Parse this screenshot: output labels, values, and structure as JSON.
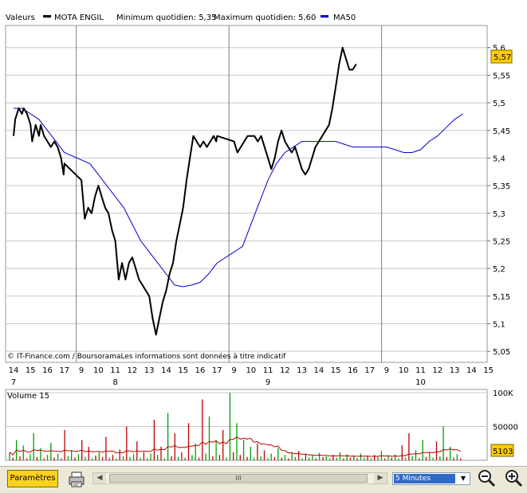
{
  "header": {
    "valeurs_label": "Valeurs",
    "series_name": "MOTA ENGIL",
    "min_label": "Minimum quotidien: 5,35",
    "max_label": "Maximum quotidien: 5,60",
    "ma_name": "MA50"
  },
  "colors": {
    "price": "#000000",
    "ma50": "#0000cc",
    "volume_up": "#00a000",
    "volume_down": "#c00000",
    "volume_ma": "#c00000",
    "badge": "#ffcc00",
    "grid": "#c8c8c8",
    "session_sep": "#808080"
  },
  "copyright": "© IT-Finance.com / BoursoramaLes informations sont données à titre indicatif",
  "price_axis": {
    "ticks": [
      "5,6",
      "5,55",
      "5,5",
      "5,45",
      "5,4",
      "5,35",
      "5,3",
      "5,25",
      "5,2",
      "5,15",
      "5,1",
      "5,05"
    ],
    "last_value": "5,57"
  },
  "time_axis": {
    "hours": [
      "14",
      "15",
      "16",
      "17",
      "9",
      "10",
      "11",
      "12",
      "13",
      "14",
      "15",
      "16",
      "17",
      "9",
      "10",
      "11",
      "12",
      "13",
      "14",
      "15",
      "16",
      "17",
      "9",
      "10",
      "11",
      "12",
      "13",
      "14",
      "15"
    ],
    "days": [
      "7",
      "8",
      "9",
      "10"
    ]
  },
  "volume_panel": {
    "title": "Volume 15",
    "ticks": [
      "100K",
      "50000"
    ],
    "last_value": "5103"
  },
  "controls": {
    "params_label": "Paramètres",
    "scroll_grip": "III",
    "interval": "5 Minutes"
  },
  "icons": {
    "print": "printer-icon",
    "zoom_out": "zoom-out-icon",
    "zoom_in": "zoom-in-icon"
  },
  "chart_data": [
    {
      "type": "line",
      "x_unit": "trading hour",
      "ylim": [
        5.03,
        5.64
      ],
      "series": [
        {
          "name": "MOTA ENGIL",
          "points": [
            [
              14.0,
              5.44
            ],
            [
              14.1,
              5.47
            ],
            [
              14.3,
              5.49
            ],
            [
              14.5,
              5.48
            ],
            [
              14.6,
              5.49
            ],
            [
              14.8,
              5.48
            ],
            [
              15.0,
              5.46
            ],
            [
              15.1,
              5.43
            ],
            [
              15.3,
              5.46
            ],
            [
              15.5,
              5.44
            ],
            [
              15.6,
              5.46
            ],
            [
              15.8,
              5.44
            ],
            [
              16.0,
              5.43
            ],
            [
              16.2,
              5.42
            ],
            [
              16.4,
              5.43
            ],
            [
              16.6,
              5.42
            ],
            [
              16.8,
              5.4
            ],
            [
              16.95,
              5.37
            ],
            [
              17.0,
              5.39
            ],
            [
              9.0,
              5.36
            ],
            [
              9.2,
              5.29
            ],
            [
              9.4,
              5.31
            ],
            [
              9.6,
              5.3
            ],
            [
              9.8,
              5.33
            ],
            [
              10.0,
              5.35
            ],
            [
              10.2,
              5.33
            ],
            [
              10.4,
              5.31
            ],
            [
              10.6,
              5.3
            ],
            [
              10.8,
              5.27
            ],
            [
              11.0,
              5.25
            ],
            [
              11.2,
              5.18
            ],
            [
              11.4,
              5.21
            ],
            [
              11.6,
              5.18
            ],
            [
              11.8,
              5.21
            ],
            [
              12.0,
              5.22
            ],
            [
              12.2,
              5.2
            ],
            [
              12.4,
              5.18
            ],
            [
              12.6,
              5.17
            ],
            [
              12.8,
              5.16
            ],
            [
              13.0,
              5.15
            ],
            [
              13.2,
              5.11
            ],
            [
              13.4,
              5.08
            ],
            [
              13.6,
              5.11
            ],
            [
              13.8,
              5.14
            ],
            [
              14.0,
              5.16
            ],
            [
              14.2,
              5.19
            ],
            [
              14.4,
              5.21
            ],
            [
              14.6,
              5.25
            ],
            [
              14.8,
              5.28
            ],
            [
              15.0,
              5.31
            ],
            [
              15.2,
              5.36
            ],
            [
              15.4,
              5.4
            ],
            [
              15.6,
              5.44
            ],
            [
              15.8,
              5.43
            ],
            [
              16.0,
              5.42
            ],
            [
              16.2,
              5.43
            ],
            [
              16.4,
              5.42
            ],
            [
              16.6,
              5.43
            ],
            [
              16.8,
              5.44
            ],
            [
              16.95,
              5.43
            ],
            [
              17.0,
              5.44
            ],
            [
              9.0,
              5.43
            ],
            [
              9.2,
              5.41
            ],
            [
              9.4,
              5.42
            ],
            [
              9.6,
              5.43
            ],
            [
              9.8,
              5.44
            ],
            [
              10.0,
              5.44
            ],
            [
              10.2,
              5.44
            ],
            [
              10.4,
              5.43
            ],
            [
              10.6,
              5.44
            ],
            [
              10.8,
              5.42
            ],
            [
              11.0,
              5.4
            ],
            [
              11.2,
              5.38
            ],
            [
              11.4,
              5.4
            ],
            [
              11.6,
              5.43
            ],
            [
              11.8,
              5.45
            ],
            [
              12.0,
              5.43
            ],
            [
              12.2,
              5.42
            ],
            [
              12.4,
              5.41
            ],
            [
              12.6,
              5.42
            ],
            [
              12.8,
              5.4
            ],
            [
              13.0,
              5.38
            ],
            [
              13.2,
              5.37
            ],
            [
              13.4,
              5.38
            ],
            [
              13.6,
              5.4
            ],
            [
              13.8,
              5.42
            ],
            [
              14.0,
              5.43
            ],
            [
              14.2,
              5.44
            ],
            [
              14.4,
              5.45
            ],
            [
              14.6,
              5.46
            ],
            [
              14.8,
              5.49
            ],
            [
              15.0,
              5.53
            ],
            [
              15.2,
              5.57
            ],
            [
              15.4,
              5.6
            ],
            [
              15.6,
              5.58
            ],
            [
              15.8,
              5.56
            ],
            [
              16.0,
              5.56
            ],
            [
              16.2,
              5.57
            ]
          ]
        },
        {
          "name": "MA50",
          "points": [
            [
              14.0,
              5.49
            ],
            [
              14.5,
              5.49
            ],
            [
              15.0,
              5.48
            ],
            [
              15.5,
              5.47
            ],
            [
              16.0,
              5.45
            ],
            [
              16.5,
              5.43
            ],
            [
              17.0,
              5.41
            ],
            [
              9.5,
              5.39
            ],
            [
              10.0,
              5.37
            ],
            [
              10.5,
              5.35
            ],
            [
              11.0,
              5.33
            ],
            [
              11.5,
              5.31
            ],
            [
              12.0,
              5.28
            ],
            [
              12.5,
              5.25
            ],
            [
              13.0,
              5.23
            ],
            [
              13.5,
              5.21
            ],
            [
              14.0,
              5.19
            ],
            [
              14.5,
              5.17
            ],
            [
              15.0,
              5.167
            ],
            [
              15.5,
              5.17
            ],
            [
              16.0,
              5.175
            ],
            [
              16.5,
              5.19
            ],
            [
              17.0,
              5.21
            ],
            [
              9.5,
              5.24
            ],
            [
              10.0,
              5.28
            ],
            [
              10.5,
              5.32
            ],
            [
              11.0,
              5.36
            ],
            [
              11.5,
              5.39
            ],
            [
              12.0,
              5.41
            ],
            [
              12.5,
              5.42
            ],
            [
              13.0,
              5.43
            ],
            [
              13.5,
              5.43
            ],
            [
              14.0,
              5.43
            ],
            [
              14.5,
              5.43
            ],
            [
              15.0,
              5.43
            ],
            [
              15.5,
              5.425
            ],
            [
              16.0,
              5.42
            ],
            [
              16.5,
              5.42
            ],
            [
              17.0,
              5.42
            ],
            [
              9.0,
              5.42
            ],
            [
              9.5,
              5.415
            ],
            [
              10.0,
              5.41
            ],
            [
              10.5,
              5.41
            ],
            [
              11.0,
              5.415
            ],
            [
              11.5,
              5.43
            ],
            [
              12.0,
              5.44
            ],
            [
              12.5,
              5.455
            ],
            [
              13.0,
              5.47
            ],
            [
              13.5,
              5.48
            ]
          ]
        }
      ]
    },
    {
      "type": "bar",
      "title": "Volume 15",
      "ylim": [
        0,
        100000
      ],
      "series": [
        {
          "name": "Volume",
          "values": [
            12000,
            4000,
            30000,
            6000,
            22000,
            3000,
            9000,
            40000,
            5000,
            18000,
            3000,
            8000,
            26000,
            4000,
            10000,
            3000,
            45000,
            6000,
            15000,
            4000,
            9000,
            30000,
            5000,
            20000,
            3000,
            7000,
            12000,
            5000,
            35000,
            4000,
            8000,
            3000,
            16000,
            6000,
            50000,
            5000,
            9000,
            28000,
            4000,
            12000,
            3000,
            10000,
            60000,
            8000,
            20000,
            3000,
            70000,
            6000,
            40000,
            5000,
            12000,
            4000,
            55000,
            8000,
            25000,
            4000,
            90000,
            10000,
            65000,
            6000,
            30000,
            8000,
            45000,
            4000,
            100000,
            12000,
            55000,
            8000,
            30000,
            5000,
            20000,
            4000,
            25000,
            6000,
            15000,
            3000,
            10000,
            5000,
            18000,
            4000,
            8000,
            3000,
            12000,
            5000,
            14000,
            3000,
            9000,
            4000,
            7000,
            3000,
            11000,
            5000,
            6000,
            3000,
            8000,
            4000,
            12000,
            3000,
            9000,
            4000,
            7000,
            3000,
            10000,
            4000,
            6000,
            3000,
            8000,
            5000,
            14000,
            3000,
            7000,
            4000,
            9000,
            3000,
            22000,
            4000,
            40000,
            6000,
            15000,
            3000,
            30000,
            5000,
            12000,
            4000,
            28000,
            6000,
            50000,
            5000,
            20000,
            4000,
            9000,
            3000
          ],
          "up": [
            true,
            false,
            true,
            false,
            true,
            false,
            true,
            true,
            false,
            true,
            false,
            true,
            true,
            false,
            true,
            false,
            false,
            true,
            true,
            false,
            true,
            false,
            true,
            false,
            true,
            false,
            true,
            false,
            false,
            true,
            false,
            true,
            false,
            true,
            false,
            true,
            true,
            false,
            true,
            false,
            true,
            true,
            false,
            true,
            false,
            true,
            true,
            false,
            false,
            true,
            false,
            true,
            false,
            true,
            true,
            false,
            false,
            true,
            true,
            false,
            true,
            false,
            false,
            true,
            true,
            false,
            true,
            false,
            true,
            false,
            true,
            true,
            false,
            true,
            false,
            true,
            true,
            false,
            true,
            false,
            true,
            false,
            true,
            true,
            false,
            true,
            false,
            true,
            true,
            false,
            true,
            false,
            true,
            true,
            false,
            true,
            true,
            false,
            true,
            false,
            true,
            false,
            true,
            true,
            false,
            true,
            false,
            true,
            true,
            false,
            true,
            false,
            true,
            true,
            false,
            true,
            false,
            true,
            true,
            false,
            true,
            false,
            true,
            true,
            false,
            true,
            true,
            false,
            true,
            false,
            true,
            false
          ]
        }
      ]
    }
  ]
}
